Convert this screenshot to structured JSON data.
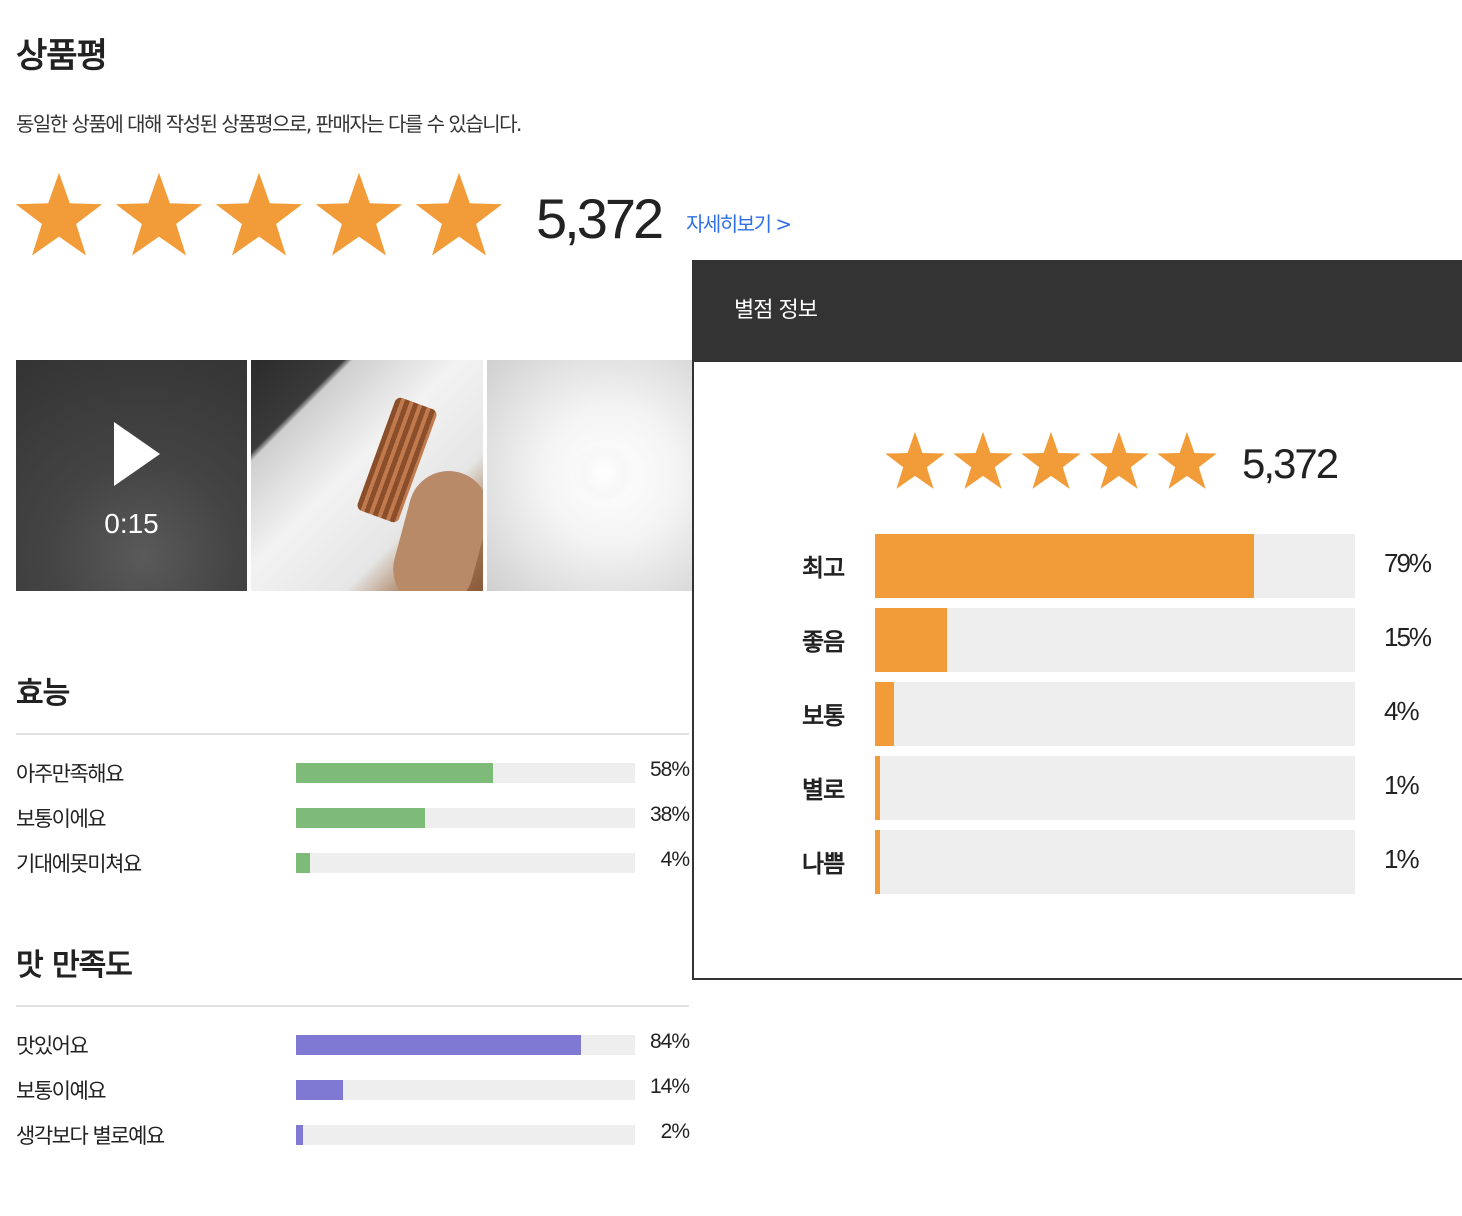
{
  "header": {
    "title": "상품평",
    "subtitle": "동일한 상품에 대해 작성된 상품평으로, 판매자는 다를 수 있습니다."
  },
  "summary": {
    "stars": 5,
    "star_color": "#f19c38",
    "review_count": "5,372",
    "detail_link": "자세히보기 >"
  },
  "media": {
    "video_duration": "0:15"
  },
  "efficacy": {
    "title": "효능",
    "color": "#7fbb78",
    "items": [
      {
        "label": "아주만족해요",
        "value": 58,
        "pct": "58%"
      },
      {
        "label": "보통이에요",
        "value": 38,
        "pct": "38%"
      },
      {
        "label": "기대에못미쳐요",
        "value": 4,
        "pct": "4%"
      }
    ]
  },
  "taste": {
    "title": "맛 만족도",
    "color": "#8079d4",
    "items": [
      {
        "label": "맛있어요",
        "value": 84,
        "pct": "84%"
      },
      {
        "label": "보통이예요",
        "value": 14,
        "pct": "14%"
      },
      {
        "label": "생각보다 별로예요",
        "value": 2,
        "pct": "2%"
      }
    ]
  },
  "rating_popup": {
    "title": "별점 정보",
    "review_count": "5,372",
    "bar_color": "#f19c38",
    "rows": [
      {
        "label": "최고",
        "value": 79,
        "pct": "79%"
      },
      {
        "label": "좋음",
        "value": 15,
        "pct": "15%"
      },
      {
        "label": "보통",
        "value": 4,
        "pct": "4%"
      },
      {
        "label": "별로",
        "value": 1,
        "pct": "1%"
      },
      {
        "label": "나쁨",
        "value": 1,
        "pct": "1%"
      }
    ]
  }
}
